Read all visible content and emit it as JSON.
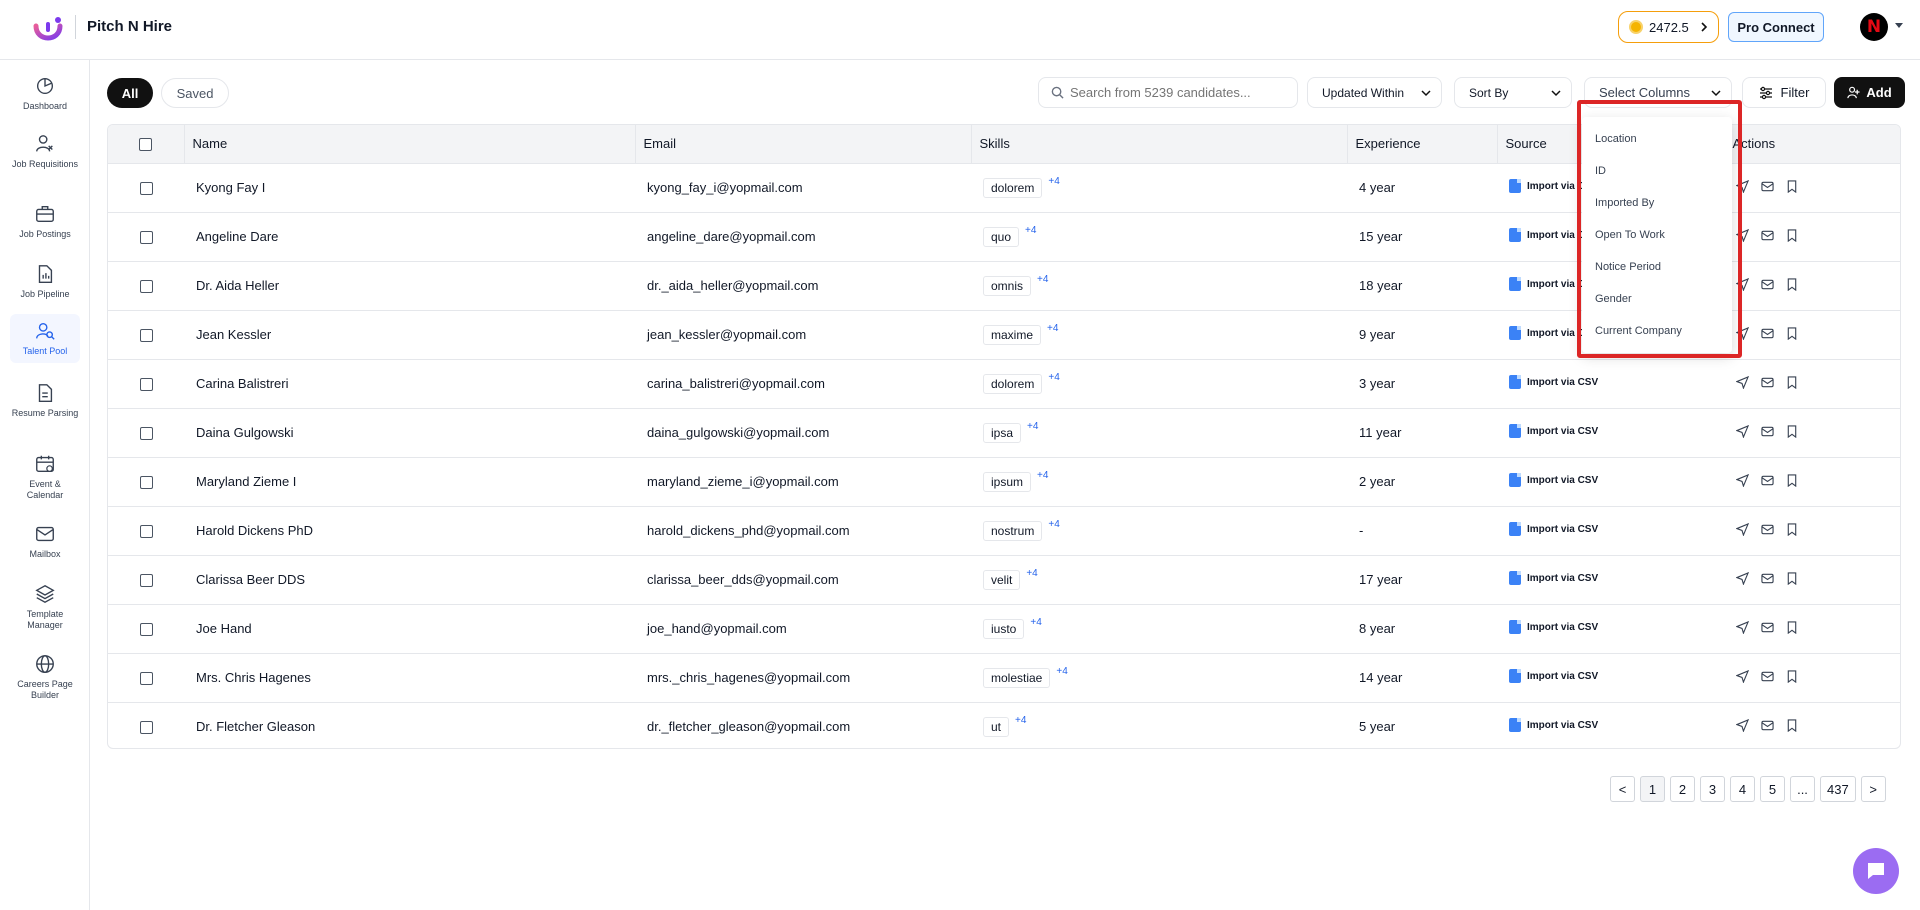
{
  "app": {
    "brand": "Pitch N Hire",
    "credits": "2472.5",
    "pro_connect": "Pro Connect",
    "avatar_letter": "N"
  },
  "sidebar": {
    "items": [
      {
        "label": "Dashboard",
        "icon": "dashboard-icon"
      },
      {
        "label": "Job Requisitions",
        "icon": "job-requisitions-icon"
      },
      {
        "label": "Job Postings",
        "icon": "briefcase-icon"
      },
      {
        "label": "Job Pipeline",
        "icon": "pipeline-icon"
      },
      {
        "label": "Talent Pool",
        "icon": "talent-pool-icon",
        "active": true
      },
      {
        "label": "Resume Parsing",
        "icon": "resume-icon"
      },
      {
        "label": "Event & Calendar",
        "icon": "calendar-icon"
      },
      {
        "label": "Mailbox",
        "icon": "mail-icon"
      },
      {
        "label": "Template Manager",
        "icon": "layers-icon"
      },
      {
        "label": "Careers Page Builder",
        "icon": "globe-icon"
      }
    ]
  },
  "toolbar": {
    "tab_all": "All",
    "tab_saved": "Saved",
    "search_placeholder": "Search from 5239 candidates...",
    "updated_within": "Updated Within",
    "sort_by": "Sort By",
    "select_columns": "Select Columns",
    "filter": "Filter",
    "add": "Add"
  },
  "table": {
    "headers": [
      "Name",
      "Email",
      "Skills",
      "Experience",
      "Source",
      "Actions"
    ],
    "rows": [
      {
        "name": "Kyong Fay I",
        "email": "kyong_fay_i@yopmail.com",
        "skill": "dolorem",
        "more": "+4",
        "experience": "4 year",
        "source": "Import via CSV"
      },
      {
        "name": "Angeline Dare",
        "email": "angeline_dare@yopmail.com",
        "skill": "quo",
        "more": "+4",
        "experience": "15 year",
        "source": "Import via CSV"
      },
      {
        "name": "Dr. Aida Heller",
        "email": "dr._aida_heller@yopmail.com",
        "skill": "omnis",
        "more": "+4",
        "experience": "18 year",
        "source": "Import via CSV"
      },
      {
        "name": "Jean Kessler",
        "email": "jean_kessler@yopmail.com",
        "skill": "maxime",
        "more": "+4",
        "experience": "9 year",
        "source": "Import via CSV"
      },
      {
        "name": "Carina Balistreri",
        "email": "carina_balistreri@yopmail.com",
        "skill": "dolorem",
        "more": "+4",
        "experience": "3 year",
        "source": "Import via CSV"
      },
      {
        "name": "Daina Gulgowski",
        "email": "daina_gulgowski@yopmail.com",
        "skill": "ipsa",
        "more": "+4",
        "experience": "11 year",
        "source": "Import via CSV"
      },
      {
        "name": "Maryland Zieme I",
        "email": "maryland_zieme_i@yopmail.com",
        "skill": "ipsum",
        "more": "+4",
        "experience": "2 year",
        "source": "Import via CSV"
      },
      {
        "name": "Harold Dickens PhD",
        "email": "harold_dickens_phd@yopmail.com",
        "skill": "nostrum",
        "more": "+4",
        "experience": "-",
        "source": "Import via CSV"
      },
      {
        "name": "Clarissa Beer DDS",
        "email": "clarissa_beer_dds@yopmail.com",
        "skill": "velit",
        "more": "+4",
        "experience": "17 year",
        "source": "Import via CSV"
      },
      {
        "name": "Joe Hand",
        "email": "joe_hand@yopmail.com",
        "skill": "iusto",
        "more": "+4",
        "experience": "8 year",
        "source": "Import via CSV"
      },
      {
        "name": "Mrs. Chris Hagenes",
        "email": "mrs._chris_hagenes@yopmail.com",
        "skill": "molestiae",
        "more": "+4",
        "experience": "14 year",
        "source": "Import via CSV"
      },
      {
        "name": "Dr. Fletcher Gleason",
        "email": "dr._fletcher_gleason@yopmail.com",
        "skill": "ut",
        "more": "+4",
        "experience": "5 year",
        "source": "Import via CSV"
      }
    ]
  },
  "columns_dropdown": {
    "options": [
      "Location",
      "ID",
      "Imported By",
      "Open To Work",
      "Notice Period",
      "Gender",
      "Current Company"
    ]
  },
  "pagination": {
    "prev": "<",
    "pages": [
      "1",
      "2",
      "3",
      "4",
      "5",
      "...",
      "437"
    ],
    "next": ">",
    "current": "1"
  },
  "colors": {
    "accent": "#2563eb",
    "credits_border": "#f59e0b",
    "highlight": "#dc2626",
    "chat": "#9b6cf2"
  }
}
